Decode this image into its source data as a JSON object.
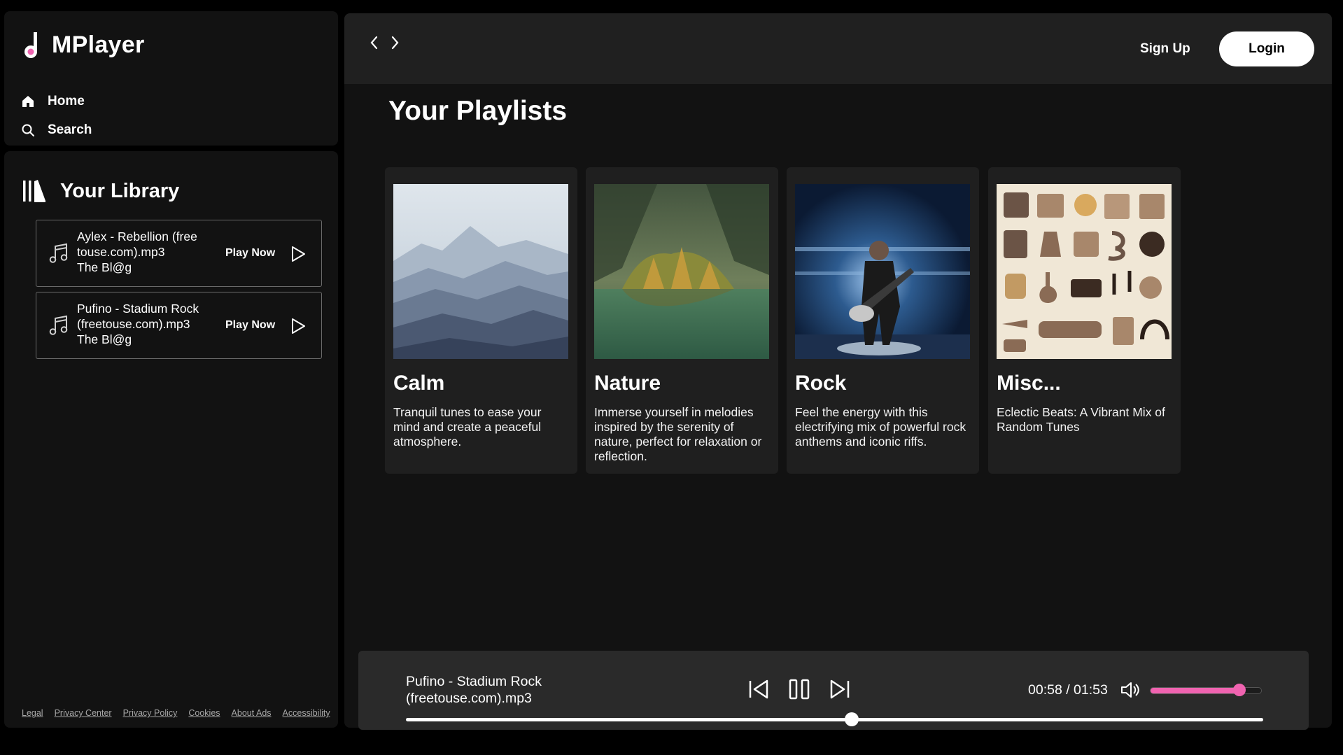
{
  "app": {
    "name": "MPlayer",
    "accent_color": "#f063b0",
    "logo_icon": "music-note-icon"
  },
  "nav": {
    "home": {
      "label": "Home",
      "icon": "home-icon"
    },
    "search": {
      "label": "Search",
      "icon": "search-icon"
    }
  },
  "library": {
    "title": "Your Library",
    "icon": "library-icon",
    "items": [
      {
        "title": "Aylex - Rebellion (free touse.com).mp3",
        "artist": "The Bl@g",
        "action": "Play Now"
      },
      {
        "title": "Pufino - Stadium Rock (freetouse.com).mp3",
        "artist": "The Bl@g",
        "action": "Play Now"
      }
    ]
  },
  "footer": {
    "links": [
      "Legal",
      "Privacy Center",
      "Privacy Policy",
      "Cookies",
      "About Ads",
      "Accessibility"
    ]
  },
  "header": {
    "signup_label": "Sign Up",
    "login_label": "Login"
  },
  "playlists": {
    "title": "Your Playlists",
    "cards": [
      {
        "title": "Calm",
        "description": "Tranquil tunes to ease your mind and create a peaceful atmosphere."
      },
      {
        "title": "Nature",
        "description": "Immerse yourself in melodies inspired by the serenity of nature, perfect for relaxation or reflection."
      },
      {
        "title": "Rock",
        "description": "Feel the energy with this electrifying mix of powerful rock anthems and iconic riffs."
      },
      {
        "title": "Misc...",
        "description": "Eclectic Beats: A Vibrant Mix of Random Tunes"
      }
    ]
  },
  "player": {
    "track": "Pufino - Stadium Rock (freetouse.com).mp3",
    "time_display": "00:58 / 01:53",
    "progress_fraction": 0.52,
    "volume_fraction": 0.8
  }
}
